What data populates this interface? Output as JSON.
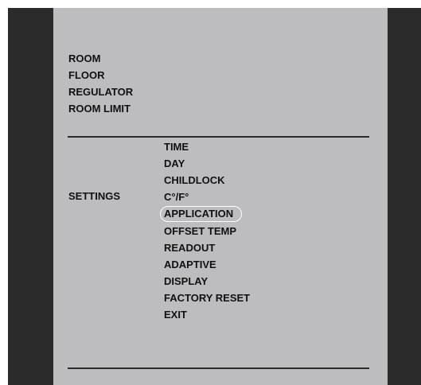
{
  "main_menu": {
    "items": [
      {
        "label": "ROOM"
      },
      {
        "label": "FLOOR"
      },
      {
        "label": "REGULATOR"
      },
      {
        "label": "ROOM LIMIT"
      }
    ]
  },
  "settings": {
    "label": "SETTINGS",
    "items": [
      {
        "label": "TIME"
      },
      {
        "label": "DAY"
      },
      {
        "label": "CHILDLOCK"
      },
      {
        "label": "C°/F°"
      },
      {
        "label": "APPLICATION",
        "selected": true
      },
      {
        "label": "OFFSET TEMP"
      },
      {
        "label": "READOUT"
      },
      {
        "label": "ADAPTIVE"
      },
      {
        "label": "DISPLAY"
      },
      {
        "label": "FACTORY RESET"
      },
      {
        "label": "EXIT"
      }
    ]
  },
  "colors": {
    "screen_background": "#bdbdbf",
    "bezel": "#2b2b2b",
    "text": "#111111",
    "selection_outline": "#ffffff"
  }
}
